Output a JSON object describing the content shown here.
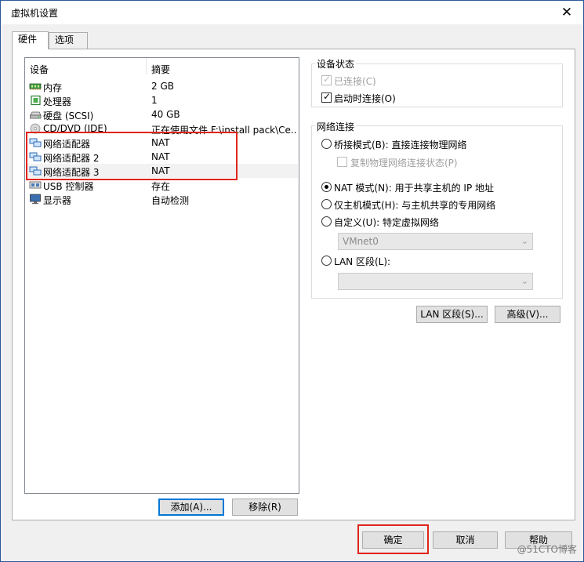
{
  "window": {
    "title": "虚拟机设置",
    "close_glyph": "✕"
  },
  "tabs": [
    {
      "label": "硬件",
      "active": true
    },
    {
      "label": "选项",
      "active": false
    }
  ],
  "device_list": {
    "headers": {
      "device": "设备",
      "summary": "摘要"
    },
    "rows": [
      {
        "name": "内存",
        "summary": "2 GB",
        "icon": "memory-icon"
      },
      {
        "name": "处理器",
        "summary": "1",
        "icon": "cpu-icon"
      },
      {
        "name": "硬盘 (SCSI)",
        "summary": "40 GB",
        "icon": "harddisk-icon"
      },
      {
        "name": "CD/DVD (IDE)",
        "summary": "正在使用文件 F:\\install pack\\Ce...",
        "icon": "cdrom-icon"
      },
      {
        "name": "网络适配器",
        "summary": "NAT",
        "icon": "network-adapter-icon"
      },
      {
        "name": "网络适配器 2",
        "summary": "NAT",
        "icon": "network-adapter-icon"
      },
      {
        "name": "网络适配器 3",
        "summary": "NAT",
        "icon": "network-adapter-icon",
        "selected": true
      },
      {
        "name": "USB 控制器",
        "summary": "存在",
        "icon": "usb-icon"
      },
      {
        "name": "显示器",
        "summary": "自动检测",
        "icon": "monitor-icon"
      }
    ],
    "add_button": "添加(A)...",
    "remove_button": "移除(R)"
  },
  "device_status": {
    "label": "设备状态",
    "connected": {
      "label": "已连接(C)",
      "checked": true,
      "disabled": true
    },
    "connect_on_start": {
      "label": "启动时连接(O)",
      "checked": true
    }
  },
  "network": {
    "label": "网络连接",
    "bridged": {
      "label": "桥接模式(B): 直接连接物理网络"
    },
    "replicate": {
      "label": "复制物理网络连接状态(P)"
    },
    "nat": {
      "label": "NAT 模式(N): 用于共享主机的 IP 地址",
      "selected": true
    },
    "hostonly": {
      "label": "仅主机模式(H): 与主机共享的专用网络"
    },
    "custom": {
      "label": "自定义(U): 特定虚拟网络"
    },
    "custom_select": "VMnet0",
    "lan": {
      "label": "LAN 区段(L):"
    },
    "lan_select": ""
  },
  "buttons": {
    "lan_segments": "LAN 区段(S)...",
    "advanced": "高级(V)...",
    "ok": "确定",
    "cancel": "取消",
    "help": "帮助"
  },
  "watermark": "@51CTO博客",
  "colors": {
    "highlight_red": "#e0241b",
    "focus_blue": "#0078d7"
  }
}
